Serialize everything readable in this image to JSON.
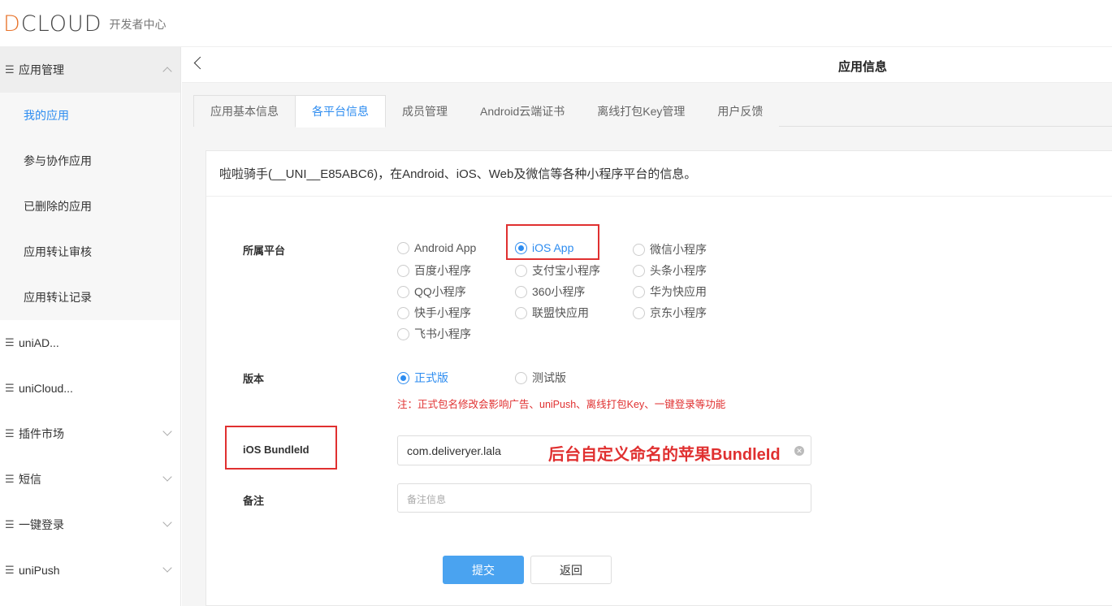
{
  "header": {
    "logo_text_accent": "D",
    "logo_text": "CLOUD",
    "logo_sub": "开发者中心"
  },
  "sidebar": {
    "app_mgmt": "应用管理",
    "items": [
      "我的应用",
      "参与协作应用",
      "已删除的应用",
      "应用转让审核",
      "应用转让记录"
    ],
    "groups": [
      "uniAD...",
      "uniCloud...",
      "插件市场",
      "短信",
      "一键登录",
      "uniPush"
    ]
  },
  "main": {
    "title": "应用信息",
    "tabs": [
      "应用基本信息",
      "各平台信息",
      "成员管理",
      "Android云端证书",
      "离线打包Key管理",
      "用户反馈"
    ],
    "description": "啦啦骑手(__UNI__E85ABC6)，在Android、iOS、Web及微信等各种小程序平台的信息。"
  },
  "form": {
    "platform_label": "所属平台",
    "platforms": [
      "Android App",
      "iOS App",
      "微信小程序",
      "百度小程序",
      "支付宝小程序",
      "头条小程序",
      "QQ小程序",
      "360小程序",
      "华为快应用",
      "快手小程序",
      "联盟快应用",
      "京东小程序",
      "飞书小程序"
    ],
    "platform_selected": "iOS App",
    "version_label": "版本",
    "versions": [
      "正式版",
      "测试版"
    ],
    "version_selected": "正式版",
    "version_note": "注：正式包名修改会影响广告、uniPush、离线打包Key、一键登录等功能",
    "bundle_label": "iOS BundleId",
    "bundle_value": "com.deliveryer.lala",
    "bundle_annotation": "后台自定义命名的苹果BundleId",
    "remark_label": "备注",
    "remark_placeholder": "备注信息",
    "submit": "提交",
    "back": "返回"
  },
  "colors": {
    "accent": "#2d8cf0",
    "annotation": "#e03030",
    "primary_button": "#4aa3f0",
    "logo_accent": "#e8732a"
  }
}
